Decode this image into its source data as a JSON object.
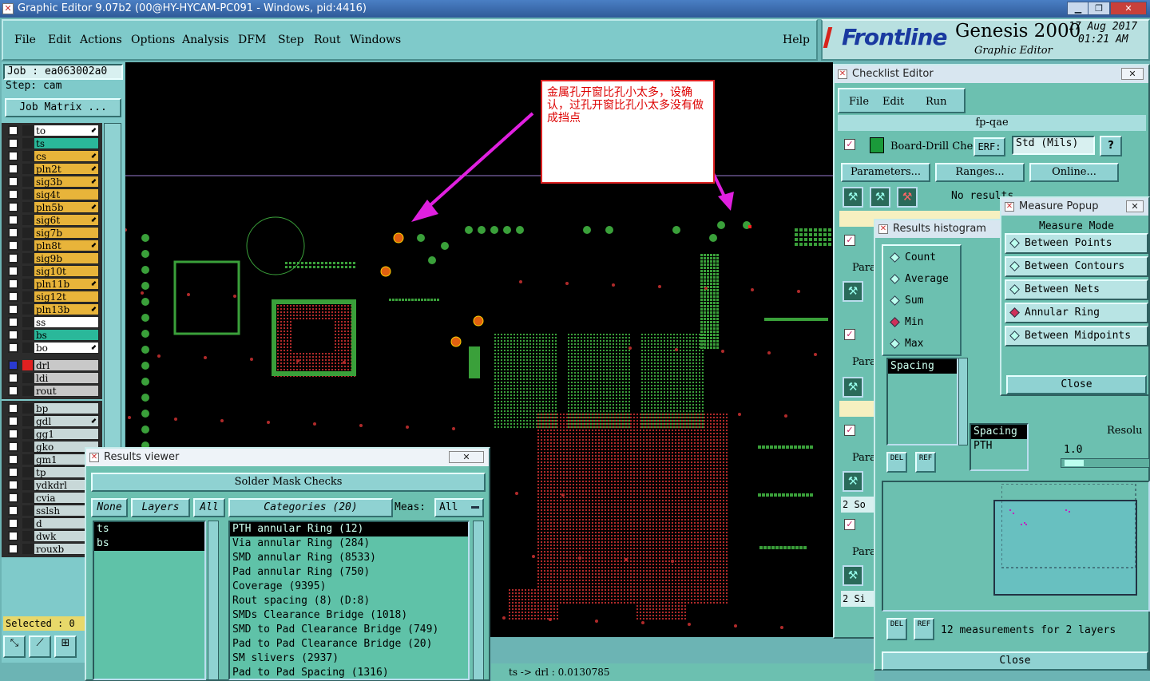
{
  "window": {
    "title": "Graphic Editor 9.07b2 (00@HY-HYCAM-PC091 - Windows, pid:4416)",
    "minimize": "▁",
    "maximize": "❐",
    "close": "✕"
  },
  "menubar": {
    "items": [
      "File",
      "Edit",
      "Actions",
      "Options",
      "Analysis",
      "DFM",
      "Step",
      "Rout",
      "Windows"
    ],
    "help": "Help"
  },
  "brand": {
    "logo": "Frontline",
    "product": "Genesis 2000",
    "subtitle": "Graphic Editor",
    "date": "17 Aug 2017",
    "time": "01:21 AM"
  },
  "sidebar": {
    "job": "Job : ea063002a0",
    "step": "Step: cam",
    "job_matrix": "Job Matrix ...",
    "layers_group1": [
      {
        "name": "to",
        "color": "#ffffff",
        "edit": true
      },
      {
        "name": "ts",
        "color": "#2ab89a",
        "edit": false
      },
      {
        "name": "cs",
        "color": "#e8b43a",
        "edit": true
      },
      {
        "name": "pln2t",
        "color": "#e8b43a",
        "edit": true
      },
      {
        "name": "sig3b",
        "color": "#e8b43a",
        "edit": true
      },
      {
        "name": "sig4t",
        "color": "#e8b43a",
        "edit": false
      },
      {
        "name": "pln5b",
        "color": "#e8b43a",
        "edit": true
      },
      {
        "name": "sig6t",
        "color": "#e8b43a",
        "edit": true
      },
      {
        "name": "sig7b",
        "color": "#e8b43a",
        "edit": false
      },
      {
        "name": "pln8t",
        "color": "#e8b43a",
        "edit": true
      },
      {
        "name": "sig9b",
        "color": "#e8b43a",
        "edit": false
      },
      {
        "name": "sig10t",
        "color": "#e8b43a",
        "edit": false
      },
      {
        "name": "pln11b",
        "color": "#e8b43a",
        "edit": true
      },
      {
        "name": "sig12t",
        "color": "#e8b43a",
        "edit": false
      },
      {
        "name": "pln13b",
        "color": "#e8b43a",
        "edit": true
      },
      {
        "name": "ss",
        "color": "#ffffff",
        "edit": false
      },
      {
        "name": "bs",
        "color": "#2ab89a",
        "edit": false
      },
      {
        "name": "bo",
        "color": "#ffffff",
        "edit": true
      }
    ],
    "layers_group2": [
      {
        "name": "drl",
        "color": "#c8c8c8"
      },
      {
        "name": "ldi",
        "color": "#c8c8c8"
      },
      {
        "name": "rout",
        "color": "#c8c8c8"
      }
    ],
    "layers_group3": [
      {
        "name": "bp",
        "edit": false
      },
      {
        "name": "gdl",
        "edit": true
      },
      {
        "name": "gg1",
        "edit": false
      },
      {
        "name": "gko",
        "edit": false
      },
      {
        "name": "gm1",
        "edit": false
      },
      {
        "name": "tp",
        "edit": false
      },
      {
        "name": "ydkdrl",
        "edit": false
      },
      {
        "name": "cvia",
        "edit": false
      },
      {
        "name": "sslsh",
        "edit": false
      },
      {
        "name": "d",
        "edit": false
      },
      {
        "name": "dwk",
        "edit": false
      },
      {
        "name": "rouxb",
        "edit": false
      }
    ],
    "selected": "Selected : 0"
  },
  "annotation": {
    "text": "金属孔开窗比孔小太多，设确认，过孔开窗比孔小太多没有做成挡点"
  },
  "status": {
    "text": "ts -> drl : 0.0130785"
  },
  "checklist": {
    "title": "Checklist Editor",
    "menu": [
      "File",
      "Edit",
      "Run"
    ],
    "name": "fp-qae",
    "row_label": "Board-Drill Che",
    "erf_label": "ERF:",
    "erf_value": "Std (Mils)",
    "help": "?",
    "buttons": [
      "Parameters...",
      "Ranges...",
      "Online..."
    ],
    "no_results": "No results",
    "side_labels": [
      "Para",
      "Para",
      "Para",
      "Para"
    ],
    "side_values": [
      "2 So",
      "2 Si"
    ],
    "red_value": "0"
  },
  "histogram": {
    "title": "Results histogram",
    "options": [
      {
        "label": "Count",
        "on": false
      },
      {
        "label": "Average",
        "on": false
      },
      {
        "label": "Sum",
        "on": false
      },
      {
        "label": "Min",
        "on": true
      },
      {
        "label": "Max",
        "on": false
      }
    ],
    "list": [
      "Spacing"
    ],
    "info_label": "Spacing",
    "info_value": "PTH",
    "resolution_label": "Resolu",
    "resolution_value": "1.0",
    "del": "DEL",
    "ref": "REF",
    "measurements": "12 measurements for 2 layers",
    "close": "Close"
  },
  "measure": {
    "title": "Measure Popup",
    "header": "Measure Mode",
    "modes": [
      {
        "label": "Between Points",
        "on": false
      },
      {
        "label": "Between Contours",
        "on": false
      },
      {
        "label": "Between Nets",
        "on": false
      },
      {
        "label": "Annular Ring",
        "on": true
      },
      {
        "label": "Between Midpoints",
        "on": false
      }
    ],
    "close": "Close"
  },
  "results": {
    "title": "Results viewer",
    "header": "Solder Mask Checks",
    "none": "None",
    "layers": "Layers",
    "all": "All",
    "categories": "Categories (20)",
    "meas": "Meas:",
    "meas_value": "All",
    "layer_list": [
      "ts",
      "bs"
    ],
    "category_list": [
      "PTH annular Ring (12)",
      "Via annular Ring (284)",
      "SMD annular Ring (8533)",
      "Pad annular Ring (750)",
      "Coverage (9395)",
      "Rout spacing (8)          (D:8)",
      "SMDs Clearance Bridge (1018)",
      "SMD to Pad Clearance Bridge (749)",
      "Pad to Pad Clearance Bridge (20)",
      "SM slivers (2937)",
      "Pad to Pad Spacing (1316)"
    ]
  }
}
